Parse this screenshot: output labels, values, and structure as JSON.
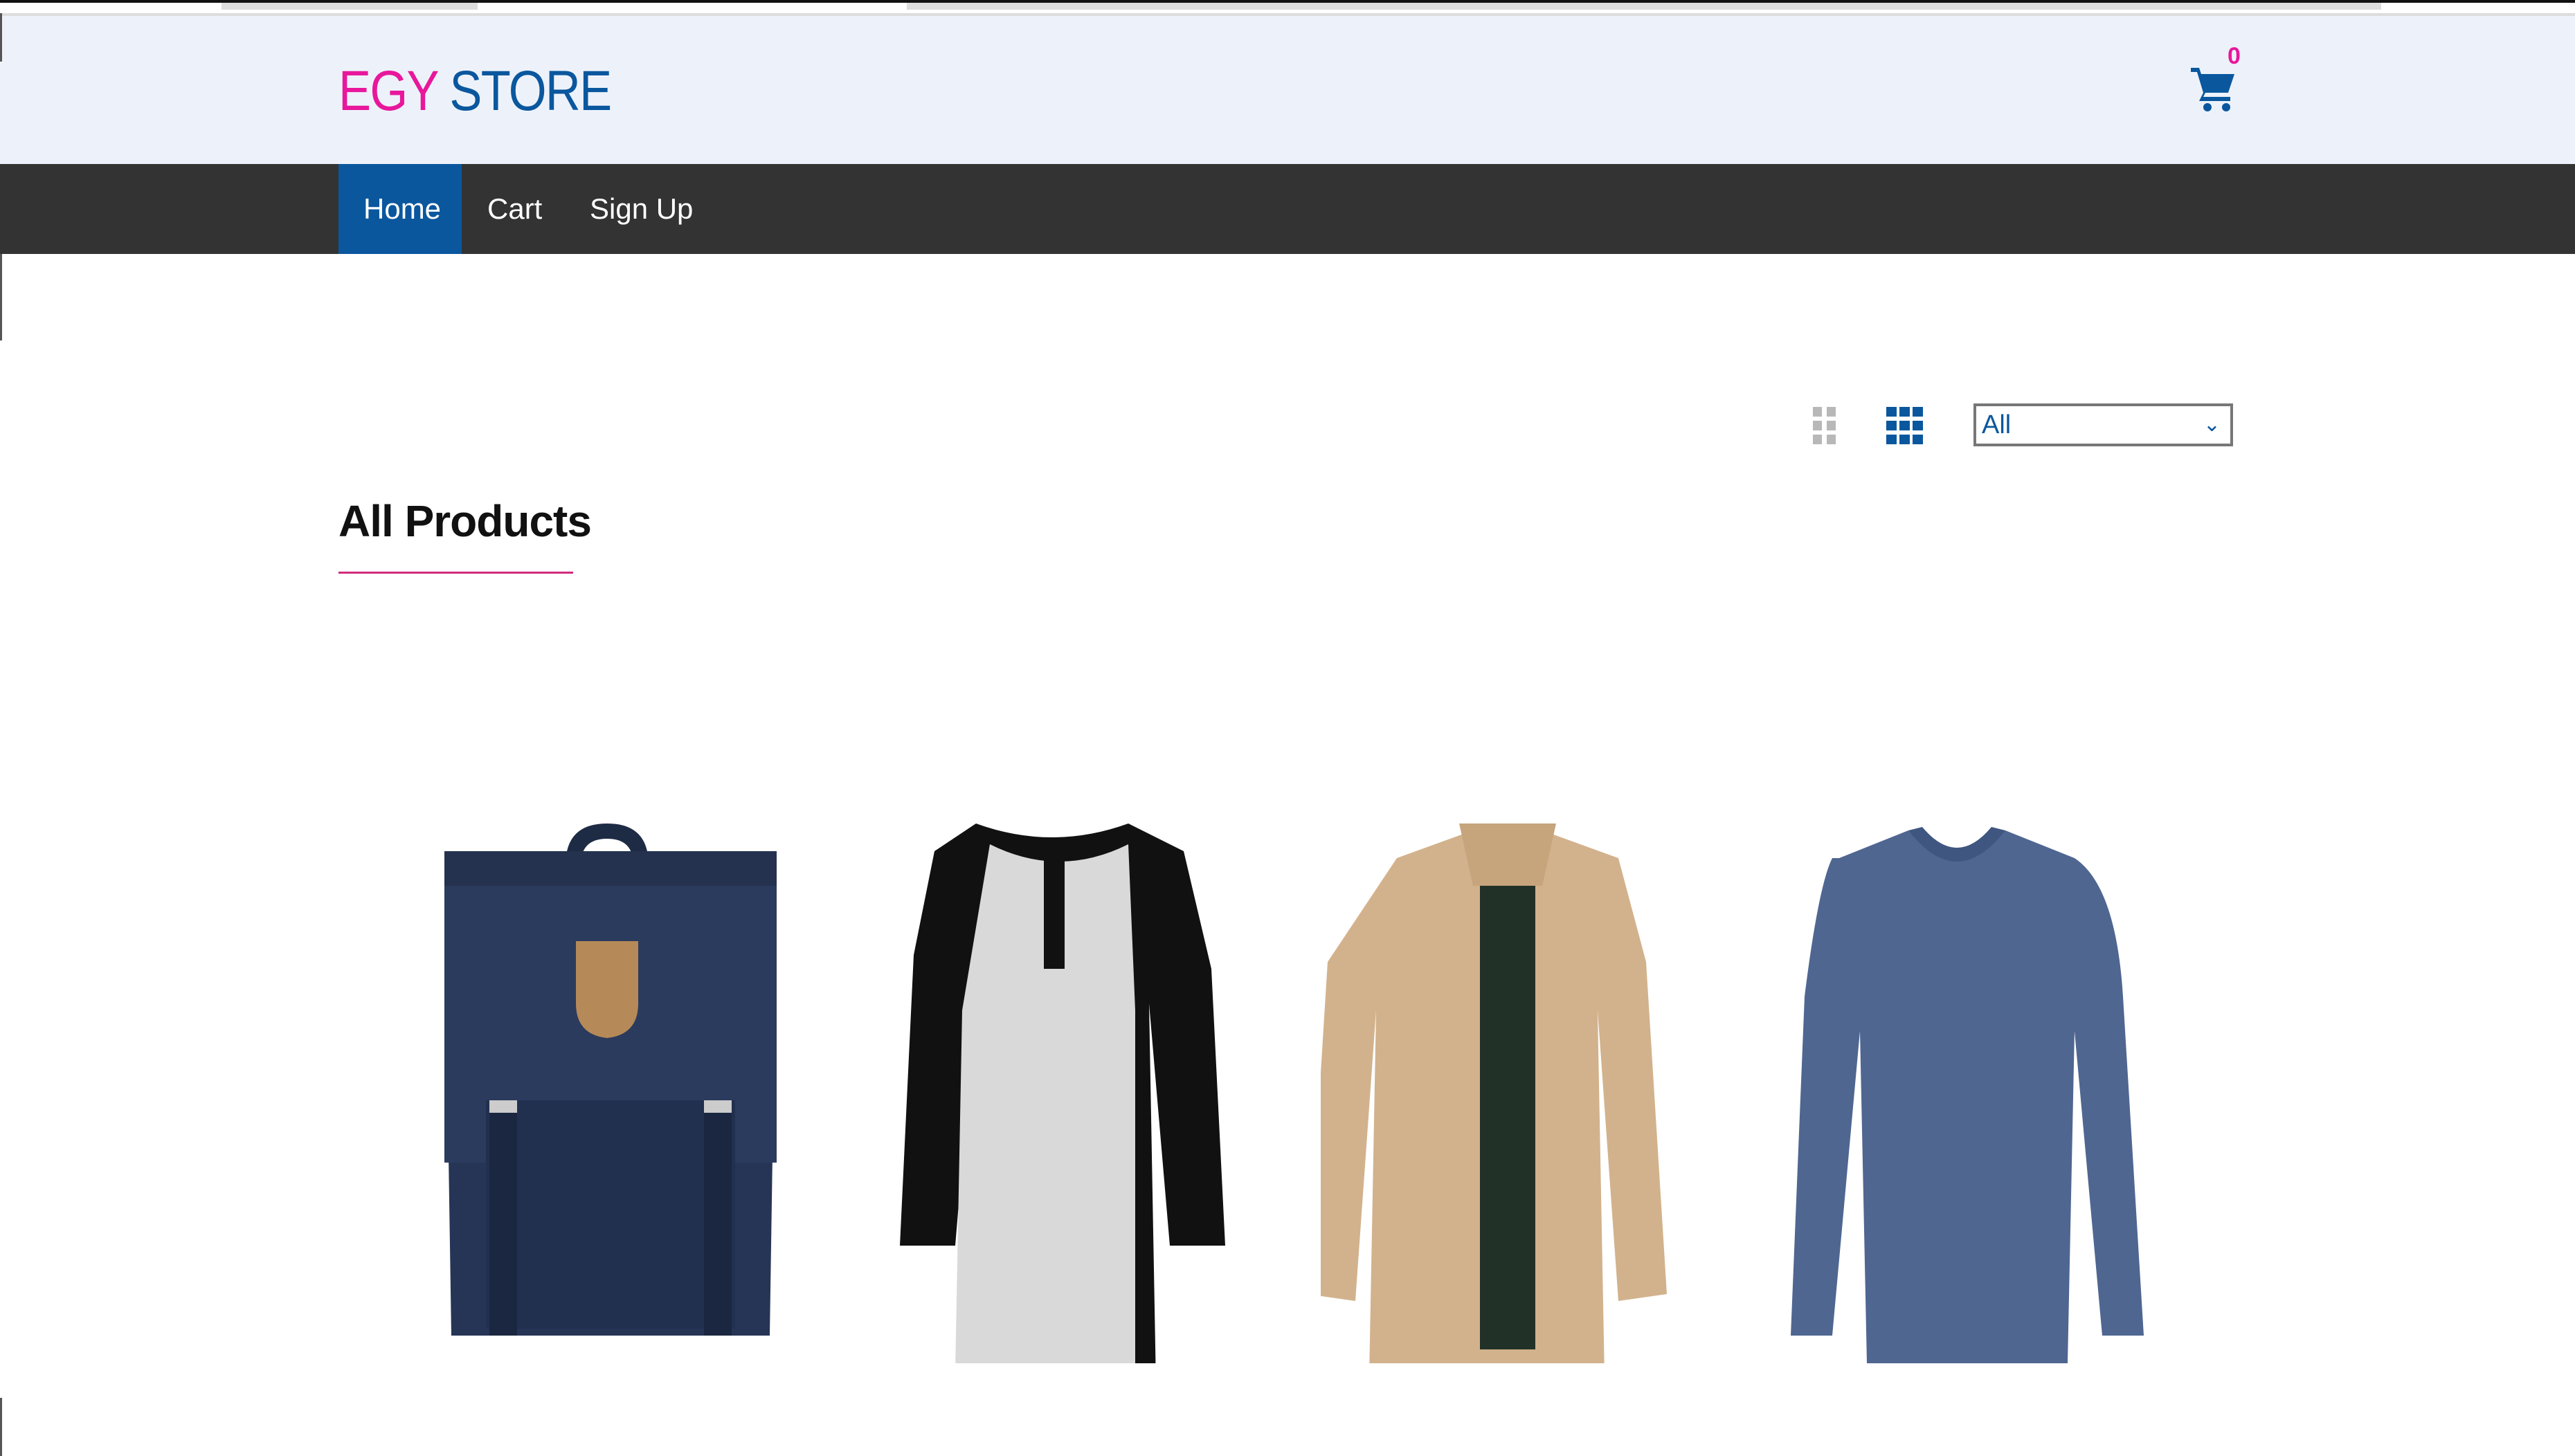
{
  "header": {
    "logo_part1": "EGY",
    "logo_part2": "STORE",
    "cart_count": "0",
    "cart_icon": "shopping-cart-icon"
  },
  "nav": {
    "items": [
      {
        "label": "Home",
        "active": true
      },
      {
        "label": "Cart"
      },
      {
        "label": "Sign Up"
      }
    ]
  },
  "toolbar": {
    "view_icons": [
      "grid-2-columns-icon",
      "grid-3-columns-icon"
    ],
    "active_view": "grid-3-columns-icon",
    "filter_selected": "All"
  },
  "main": {
    "title": "All Products"
  },
  "products": [
    {
      "image": "navy backpack"
    },
    {
      "image": "raglan henley shirt"
    },
    {
      "image": "beige jacket"
    },
    {
      "image": "blue long-sleeve v-neck"
    }
  ],
  "colors": {
    "brand_pink": "#e8179c",
    "brand_blue": "#0a579e",
    "nav_bg": "#333333",
    "header_bg": "#edf2fa"
  }
}
